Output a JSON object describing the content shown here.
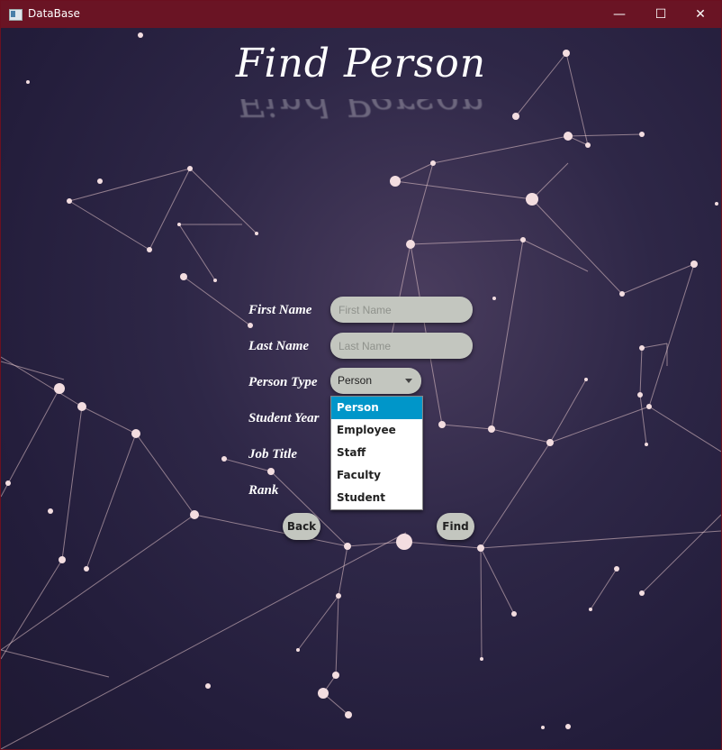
{
  "window": {
    "title": "DataBase",
    "minimize": "—",
    "maximize": "☐",
    "close": "✕"
  },
  "heading": "Find Person",
  "form": {
    "first_name_label": "First Name",
    "first_name_placeholder": "First Name",
    "last_name_label": "Last Name",
    "last_name_placeholder": "Last Name",
    "person_type_label": "Person Type",
    "person_type_value": "Person",
    "student_year_label": "Student Year",
    "job_title_label": "Job Title",
    "rank_label": "Rank"
  },
  "dropdown": {
    "options": [
      "Person",
      "Employee",
      "Staff",
      "Faculty",
      "Student"
    ],
    "selected": "Person"
  },
  "buttons": {
    "back": "Back",
    "find": "Find"
  },
  "colors": {
    "titlebar": "#6a1424",
    "selection": "#0096c9",
    "control": "#c3c6bf"
  }
}
